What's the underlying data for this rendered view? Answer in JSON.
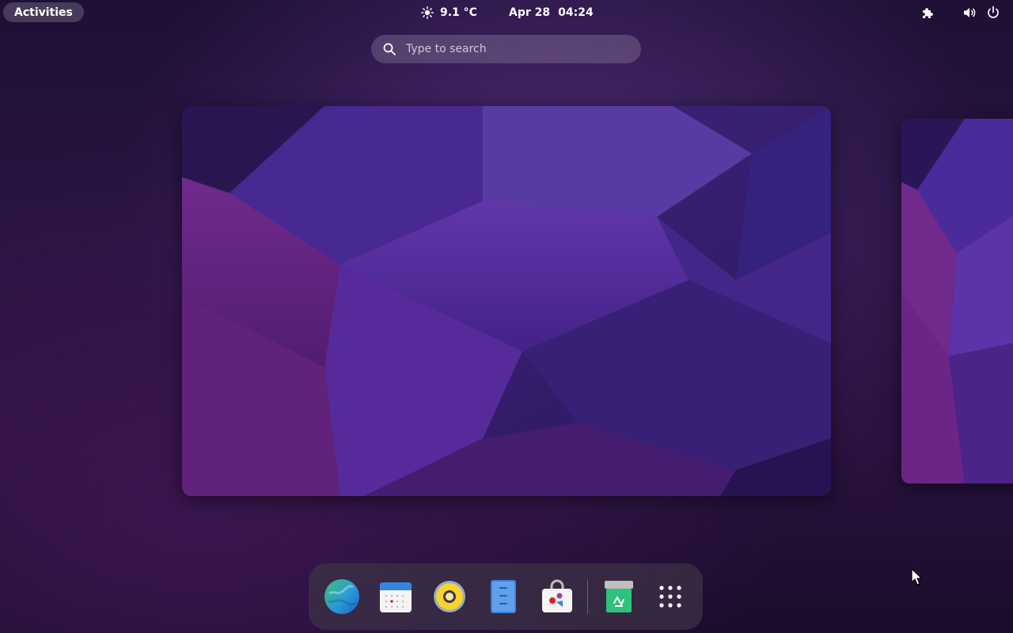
{
  "topbar": {
    "activities_label": "Activities",
    "weather": {
      "icon": "sun-icon",
      "temperature": "9.1 °C"
    },
    "clock": {
      "date": "Apr 28",
      "time": "04:24"
    },
    "tray": [
      "extensions-icon",
      "volume-icon",
      "power-icon"
    ]
  },
  "search": {
    "placeholder": "Type to search",
    "value": ""
  },
  "workspaces": [
    {
      "name": "Workspace 1",
      "active": true
    },
    {
      "name": "Workspace 2",
      "active": false
    }
  ],
  "dock": {
    "apps": [
      {
        "name": "Web Browser",
        "icon": "globe-icon"
      },
      {
        "name": "Calendar",
        "icon": "calendar-icon"
      },
      {
        "name": "Rhythmbox",
        "icon": "speaker-icon"
      },
      {
        "name": "Text Editor",
        "icon": "notepad-icon"
      },
      {
        "name": "Software",
        "icon": "shopping-bag-icon"
      },
      {
        "name": "Trash",
        "icon": "trash-icon"
      },
      {
        "name": "Show Apps",
        "icon": "app-grid-icon"
      }
    ]
  },
  "colors": {
    "accent": "#ffffff",
    "wallpaper_primary": "#5a2fa0",
    "wallpaper_secondary": "#3a1f7a",
    "wallpaper_magenta": "#7a2a8a"
  }
}
